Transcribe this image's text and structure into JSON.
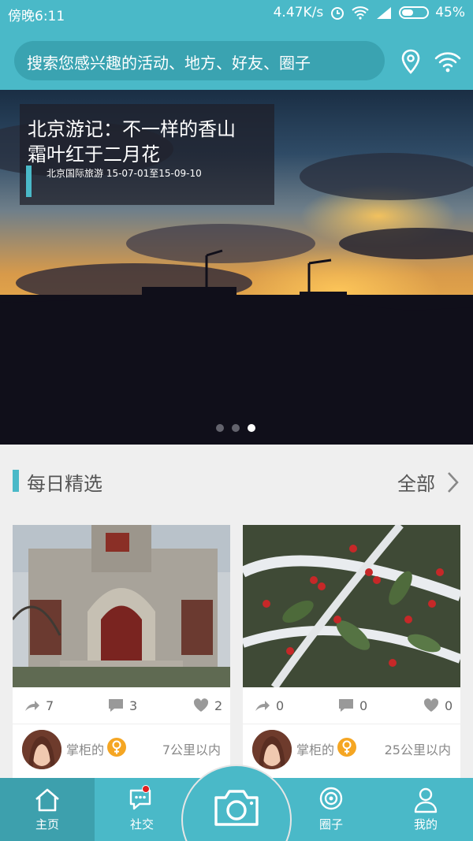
{
  "status_bar": {
    "time": "傍晚6:11",
    "network_speed": "4.47K/s",
    "battery": "45%",
    "icons": [
      "alarm-icon",
      "wifi-icon",
      "signal-icon",
      "battery-icon"
    ]
  },
  "header": {
    "search_placeholder": "搜索您感兴趣的活动、地方、好友、圈子",
    "icons": [
      "location-pin-icon",
      "wifi-broadcast-icon"
    ]
  },
  "banner": {
    "title_line1": "北京游记：不一样的香山",
    "title_line2": "霜叶红于二月花",
    "subtitle": "北京国际旅游 15-07-01至15-09-10",
    "pages": 3,
    "active_page": 3
  },
  "section": {
    "title": "每日精选",
    "all_label": "全部"
  },
  "cards": [
    {
      "image": "building-photo",
      "shares": "7",
      "comments": "3",
      "likes": "2",
      "user": "掌柜的",
      "distance": "7公里以内"
    },
    {
      "image": "snow-berries-photo",
      "shares": "0",
      "comments": "0",
      "likes": "0",
      "user": "掌柜的",
      "distance": "25公里以内"
    }
  ],
  "tabs": [
    {
      "label": "主页",
      "icon": "home-icon",
      "active": true
    },
    {
      "label": "社交",
      "icon": "chat-icon",
      "badge": true
    },
    {
      "label": "",
      "icon": "camera-icon"
    },
    {
      "label": "圈子",
      "icon": "circle-icon"
    },
    {
      "label": "我的",
      "icon": "user-icon"
    }
  ],
  "colors": {
    "primary": "#4ab9c8",
    "primary_dark": "#3da0ad",
    "badge": "#e02020",
    "female": "#f5a623"
  }
}
